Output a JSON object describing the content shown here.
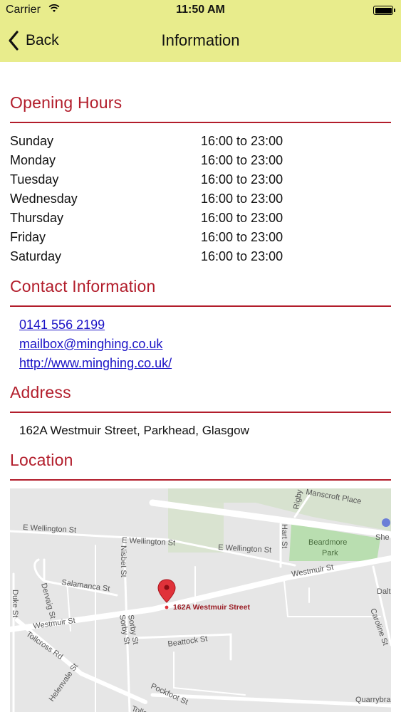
{
  "status_bar": {
    "carrier": "Carrier",
    "time": "11:50 AM"
  },
  "nav": {
    "back_label": "Back",
    "title": "Information"
  },
  "opening_hours": {
    "title": "Opening Hours",
    "rows": [
      {
        "day": "Sunday",
        "hours": "16:00 to 23:00"
      },
      {
        "day": "Monday",
        "hours": "16:00 to 23:00"
      },
      {
        "day": "Tuesday",
        "hours": "16:00 to 23:00"
      },
      {
        "day": "Wednesday",
        "hours": "16:00 to 23:00"
      },
      {
        "day": "Thursday",
        "hours": "16:00 to 23:00"
      },
      {
        "day": "Friday",
        "hours": "16:00 to 23:00"
      },
      {
        "day": "Saturday",
        "hours": "16:00 to 23:00"
      }
    ]
  },
  "contact": {
    "title": "Contact Information",
    "phone": "0141 556 2199",
    "email": "mailbox@minghing.co.uk",
    "website": "http://www.minghing.co.uk/"
  },
  "address": {
    "title": "Address",
    "text": "162A Westmuir Street, Parkhead, Glasgow"
  },
  "location": {
    "title": "Location",
    "marker_label": "162A Westmuir Street",
    "street_labels": {
      "wellington_w": "E Wellington St",
      "wellington_mid": "E Wellington St",
      "wellington_e": "E Wellington St",
      "manscroft": "Manscroft Place",
      "beardmore": "Beardmore",
      "park": "Park",
      "hart": "Hart St",
      "rigby": "Rigby St",
      "salamanca": "Salamanca St",
      "nisbet": "Nisbet St",
      "duke": "Duke St",
      "dervaig": "Dervaig St",
      "westmuir_w": "Westmuir St",
      "westmuir_e": "Westmuir St",
      "tollcross": "Tollcross Rd",
      "sorby1": "Sorby St",
      "sorby2": "Sorby St",
      "beattock": "Beattock St",
      "helenvale": "Helenvale St",
      "pockfoot": "Pockfoot St",
      "quarrybrae": "Quarrybrae",
      "caroline": "Caroline St",
      "dalt": "Dalt",
      "she": "She",
      "tollcr": "Tollcros"
    },
    "colors": {
      "park": "#b9deb0",
      "green_area": "#d7e2cf",
      "marker": "#e0323a",
      "roads": "#ffffff"
    }
  },
  "colors": {
    "accent": "#b21d2b",
    "header_bg": "#e8ec8c",
    "link": "#1a12c6"
  }
}
